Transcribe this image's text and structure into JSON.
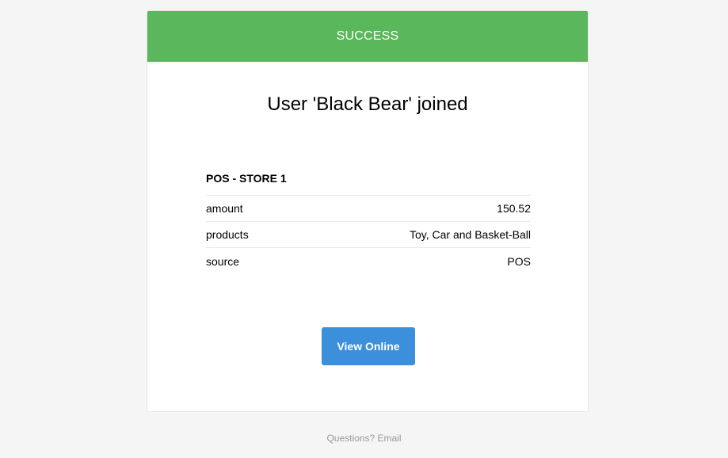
{
  "banner": {
    "label": "SUCCESS",
    "color": "#5bb75b"
  },
  "headline": "User 'Black Bear' joined",
  "details": {
    "title": "POS - STORE 1",
    "rows": [
      {
        "key": "amount",
        "value": "150.52"
      },
      {
        "key": "products",
        "value": "Toy, Car and Basket-Ball"
      },
      {
        "key": "source",
        "value": "POS"
      }
    ]
  },
  "action": {
    "label": "View Online",
    "color": "#3b8fdb"
  },
  "footer": {
    "text": "Questions? Email"
  }
}
